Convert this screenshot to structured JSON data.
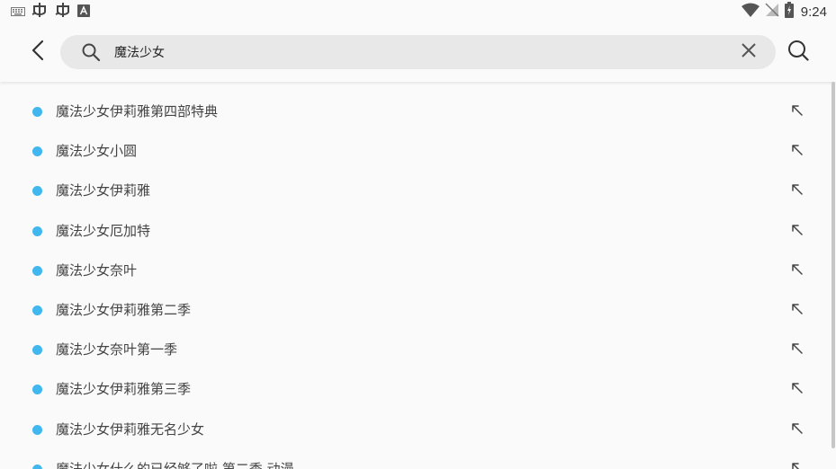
{
  "status_bar": {
    "time": "9:24",
    "icons": [
      "keyboard-icon",
      "bug-icon",
      "bug-icon",
      "a-box-icon",
      "wifi-icon",
      "no-signal-icon",
      "battery-charging-icon"
    ]
  },
  "header": {
    "search": {
      "value": "魔法少女",
      "icons": [
        "back-arrow-icon",
        "search-icon",
        "close-icon",
        "search-icon"
      ]
    }
  },
  "suggestions": [
    "魔法少女伊莉雅第四部特典",
    "魔法少女小圆",
    "魔法少女伊莉雅",
    "魔法少女厄加特",
    "魔法少女奈叶",
    "魔法少女伊莉雅第二季",
    "魔法少女奈叶第一季",
    "魔法少女伊莉雅第三季",
    "魔法少女伊莉雅无名少女",
    "魔法少女什么的已经够了啦 第二季 动漫"
  ],
  "colors": {
    "bullet": "#40b7ee",
    "search_box_bg": "#e8e8e8",
    "background": "#fafafa",
    "text": "#444444"
  }
}
